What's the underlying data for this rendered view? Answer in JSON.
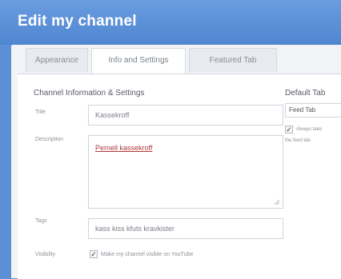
{
  "header": {
    "title": "Edit my channel"
  },
  "tabs": [
    {
      "label": "Appearance"
    },
    {
      "label": "Info and Settings"
    },
    {
      "label": "Featured Tab"
    }
  ],
  "section": {
    "title": "Channel Information & Settings",
    "title_label": "Title",
    "title_value": "Kassekroff",
    "description_label": "Description",
    "description_value": "Pernell kassekroff",
    "tags_label": "Tags",
    "tags_value": "kass kiss kfuts kravkister",
    "visibility_label": "Visibility",
    "visibility_text": "Make my channel visible on YouTube"
  },
  "default_tab": {
    "title": "Default Tab",
    "selected": "Feed Tab",
    "always_label": "Always take",
    "subtext": "the feed tab"
  }
}
